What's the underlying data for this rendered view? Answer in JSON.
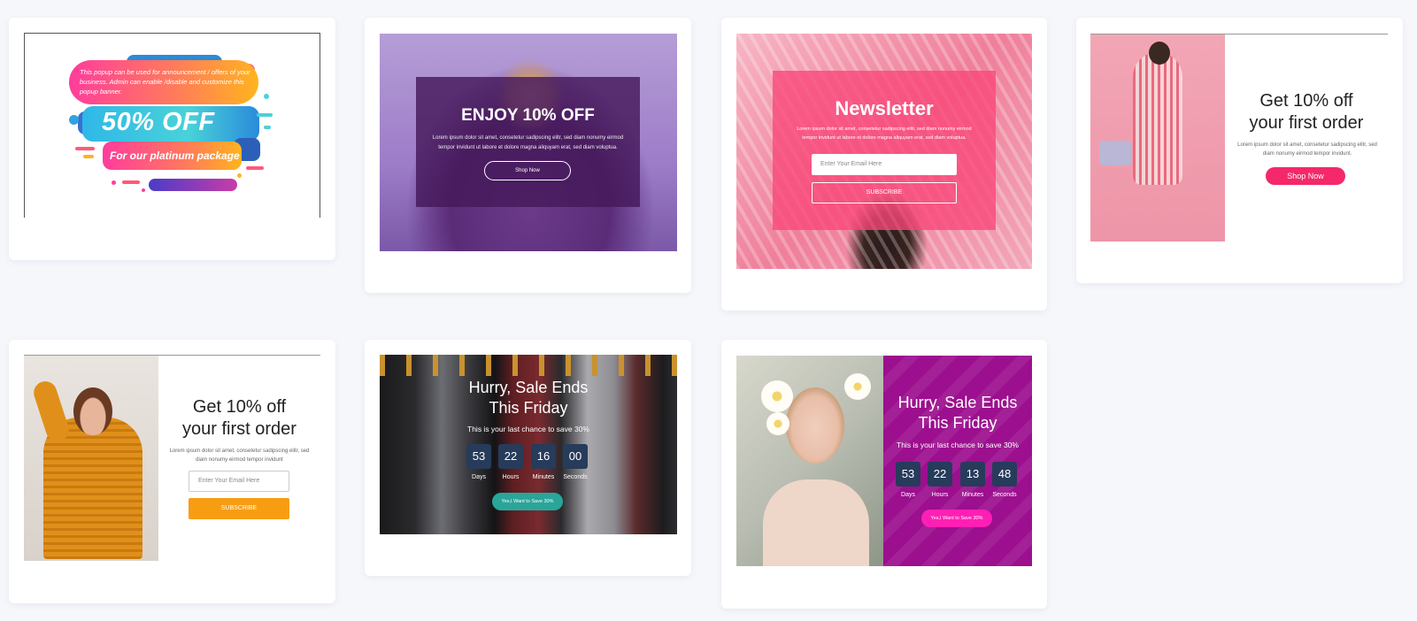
{
  "templates": {
    "t1": {
      "announcement": "This popup can be used for announcement / offers of your business. Admin can enable /disable and customize this popup banner.",
      "headline": "50% OFF",
      "subline": "For our platinum package"
    },
    "t2": {
      "title": "ENJOY 10% OFF",
      "text": "Lorem ipsum dolor sit amet, consetetur sadipscing elitr, sed diam nonumy eirmod tempor invidunt ut labore et dolore magna aliquyam erat, sed diam voluptua.",
      "button": "Shop Now"
    },
    "t3": {
      "title": "Newsletter",
      "text": "Lorem ipsum dolor sit amet, consetetur sadipscing elitr, sed diam nonumy eirmod tempor invidunt ut labore et dolore magna aliquyam erat, sed diam voluptua.",
      "email_placeholder": "Enter Your Email Here",
      "button": "SUBSCRIBE"
    },
    "t4": {
      "title_line1": "Get 10% off",
      "title_line2": "your first order",
      "text": "Lorem ipsum dolor sit amet, consetetur sadipscing elitr, sed diam nonumy eirmod tempor invidunt.",
      "button": "Shop Now"
    },
    "t5": {
      "title_line1": "Get 10% off",
      "title_line2": "your first order",
      "text": "Lorem ipsum dolor sit amet, consetetur sadipscing elitr, sed diam nonumy eirmod tempor invidunt",
      "email_placeholder": "Enter Your Email Here",
      "button": "SUBSCRIBE"
    },
    "t6": {
      "title_line1": "Hurry, Sale Ends",
      "title_line2": "This Friday",
      "subtitle": "This is your last chance to save 30%",
      "days": "53",
      "hours": "22",
      "minutes": "16",
      "seconds": "00",
      "days_label": "Days",
      "hours_label": "Hours",
      "minutes_label": "Minutes",
      "seconds_label": "Seconds",
      "button": "Yes,I Want to Save 30%"
    },
    "t7": {
      "title_line1": "Hurry, Sale Ends",
      "title_line2": "This Friday",
      "subtitle": "This is your last chance to save 30%",
      "days": "53",
      "hours": "22",
      "minutes": "13",
      "seconds": "48",
      "days_label": "Days",
      "hours_label": "Hours",
      "minutes_label": "Minutes",
      "seconds_label": "Seconds",
      "button": "Yes,I Want to Save 30%"
    }
  },
  "colors": {
    "page_bg": "#f5f7fb",
    "pink_accent": "#f4286a",
    "orange_accent": "#f79d12",
    "teal_accent": "#2aa59a",
    "magenta_accent": "#ff1fb4",
    "countdown_box": "#273b5b"
  }
}
